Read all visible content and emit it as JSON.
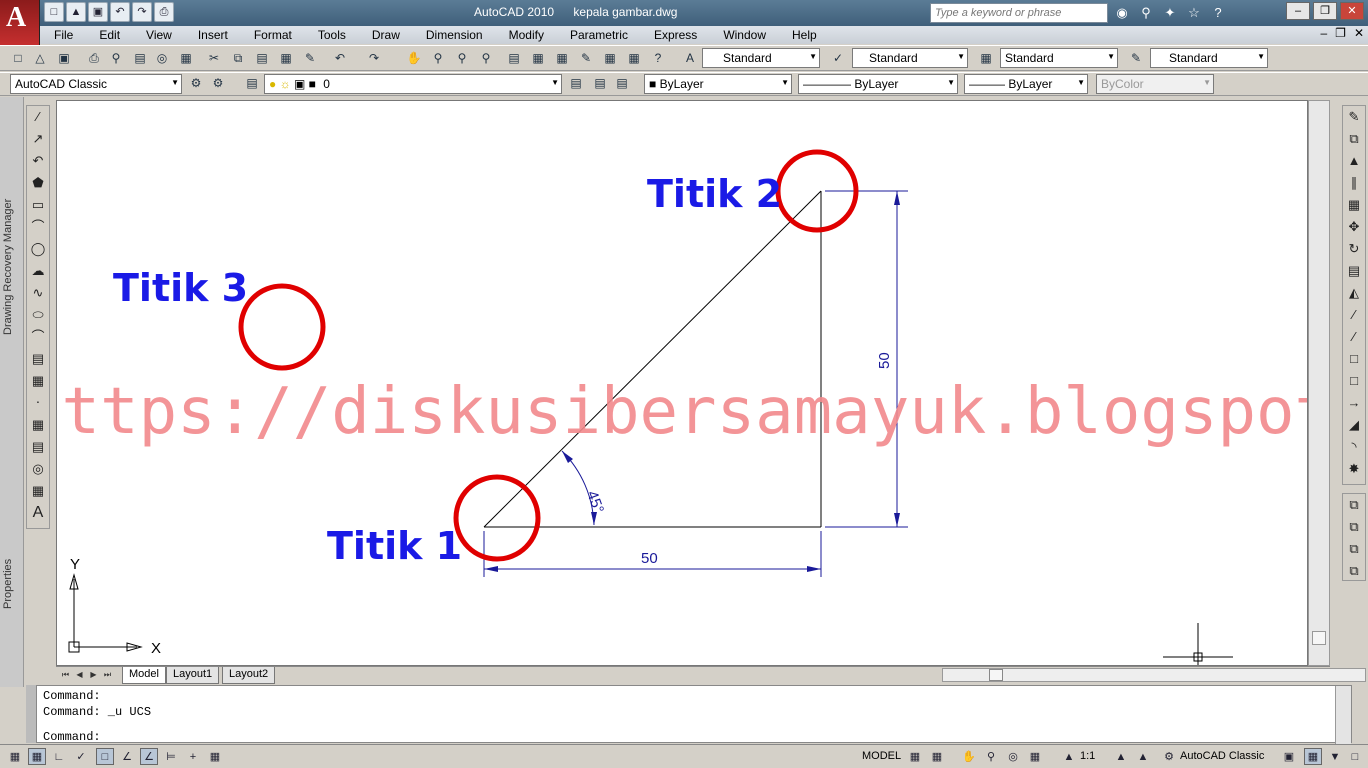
{
  "app": {
    "logo_letter": "A",
    "name": "AutoCAD 2010",
    "document": "kepala gambar.dwg"
  },
  "quick_access": [
    "new-icon",
    "open-icon",
    "save-icon",
    "undo-icon",
    "redo-icon",
    "plot-icon"
  ],
  "search": {
    "placeholder": "Type a keyword or phrase"
  },
  "menu": [
    "File",
    "Edit",
    "View",
    "Insert",
    "Format",
    "Tools",
    "Draw",
    "Dimension",
    "Modify",
    "Parametric",
    "Express",
    "Window",
    "Help"
  ],
  "styles": {
    "text_style": "Standard",
    "dim_style": "Standard",
    "table_style": "Standard",
    "mleader_style": "Standard"
  },
  "workspace": {
    "name": "AutoCAD Classic"
  },
  "layer": {
    "current": "0"
  },
  "properties": {
    "color": "ByLayer",
    "linetype": "ByLayer",
    "lineweight": "ByLayer",
    "plotstyle": "ByColor"
  },
  "panels": {
    "recovery": "Drawing Recovery Manager",
    "properties": "Properties"
  },
  "drawing": {
    "labels": {
      "point1": "Titik 1",
      "point2": "Titik 2",
      "point3": "Titik 3"
    },
    "dimensions": {
      "horizontal": "50",
      "vertical": "50",
      "angle": "45°"
    },
    "ucs": {
      "x": "X",
      "y": "Y"
    },
    "watermark": "https://diskusibersamayuk.blogspot.com/",
    "colors": {
      "label": "#1a1ae6",
      "circle": "#e00000",
      "dimension": "#1a1a99",
      "watermark": "#f2898c"
    }
  },
  "tabs": [
    "Model",
    "Layout1",
    "Layout2"
  ],
  "command": {
    "lines": [
      "Command:",
      "Command:  _u UCS"
    ],
    "prompt": "Command:"
  },
  "status": {
    "model": "MODEL",
    "annotation_scale": "1:1",
    "workspace": "AutoCAD Classic"
  }
}
